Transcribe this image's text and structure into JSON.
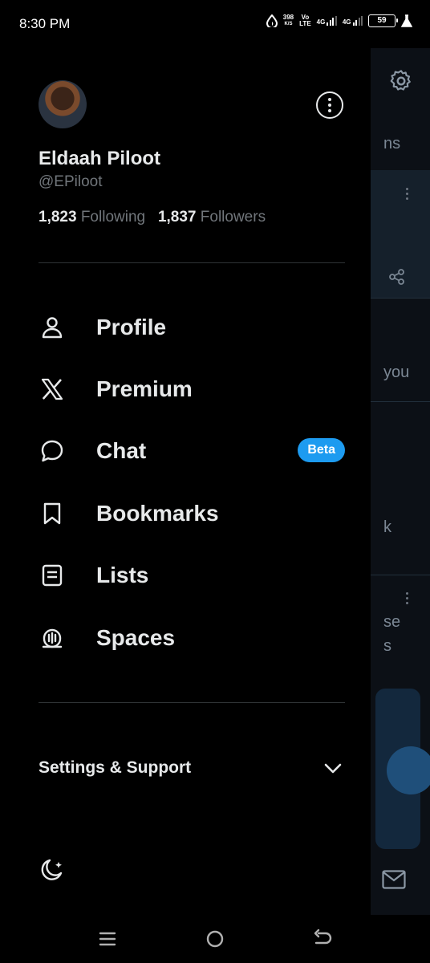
{
  "status_bar": {
    "time": "8:30 PM",
    "net_speed": "398",
    "net_unit": "K/S",
    "volte_top": "Vo",
    "volte_bottom": "LTE",
    "sim1": "4G",
    "sim2": "4G",
    "battery": "59"
  },
  "profile": {
    "name": "Eldaah Piloot",
    "handle": "@EPiloot",
    "following_count": "1,823",
    "following_label": "Following",
    "followers_count": "1,837",
    "followers_label": "Followers"
  },
  "menu": {
    "items": [
      {
        "label": "Profile",
        "icon": "person-icon"
      },
      {
        "label": "Premium",
        "icon": "x-logo-icon"
      },
      {
        "label": "Chat",
        "icon": "chat-bubble-icon",
        "badge": "Beta"
      },
      {
        "label": "Bookmarks",
        "icon": "bookmark-icon"
      },
      {
        "label": "Lists",
        "icon": "list-icon"
      },
      {
        "label": "Spaces",
        "icon": "spaces-mic-icon"
      }
    ]
  },
  "settings": {
    "label": "Settings & Support"
  },
  "background": {
    "tab_fragment": "ns",
    "text_you": "you",
    "text_k": "k",
    "text_se": "se",
    "text_s": "s"
  },
  "colors": {
    "accent": "#1d9bf0",
    "background": "#000000",
    "secondary_text": "#71767b"
  }
}
